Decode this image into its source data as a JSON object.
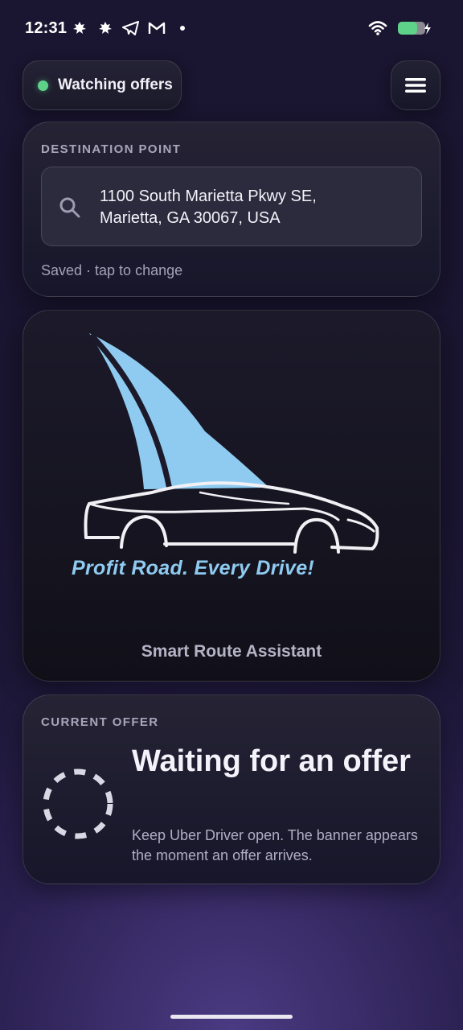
{
  "status_bar": {
    "time": "12:31",
    "left_icons": [
      "leaf-icon",
      "leaf-icon",
      "telegram-icon",
      "gmail-icon",
      "dot-icon"
    ],
    "right_icons": [
      "wifi-icon",
      "battery-charging-icon"
    ],
    "battery_color": "#5ED289"
  },
  "header": {
    "status_pill_label": "Watching offers",
    "status_color": "#5ED289",
    "menu_icon": "hamburger-menu-icon"
  },
  "destination": {
    "section_label": "DESTINATION POINT",
    "address_line1": "1100 South Marietta Pkwy SE,",
    "address_line2": "Marietta, GA 30067, USA",
    "hint": "Saved · tap to change"
  },
  "logo_card": {
    "tagline": "Profit Road. Every Drive!",
    "subtitle": "Smart Route Assistant",
    "sail_color": "#8FCBF1"
  },
  "offer": {
    "section_label": "CURRENT OFFER",
    "title": "Waiting for an offer",
    "description": "Keep Uber Driver open. The banner appears the moment an offer arrives."
  }
}
